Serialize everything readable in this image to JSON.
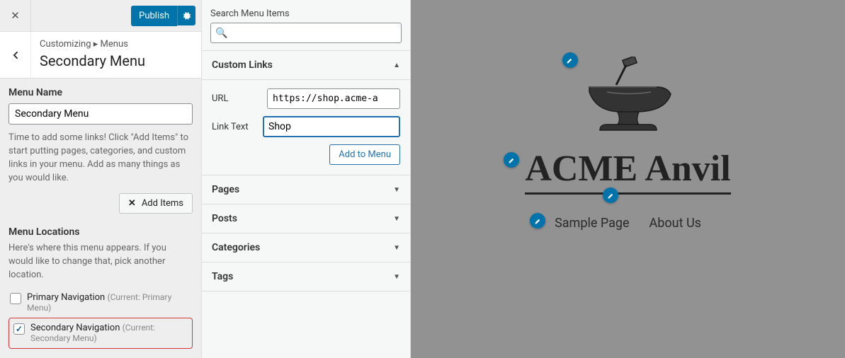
{
  "top": {
    "publish_label": "Publish"
  },
  "header": {
    "breadcrumb_prefix": "Customizing",
    "breadcrumb_section": "Menus",
    "title": "Secondary Menu"
  },
  "menu_name": {
    "label": "Menu Name",
    "value": "Secondary Menu"
  },
  "help": "Time to add some links! Click \"Add Items\" to start putting pages, categories, and custom links in your menu. Add as many things as you would like.",
  "add_items_label": "Add Items",
  "locations": {
    "label": "Menu Locations",
    "help": "Here's where this menu appears. If you would like to change that, pick another location.",
    "items": [
      {
        "label": "Primary Navigation",
        "current": "(Current: Primary Menu)",
        "checked": false,
        "highlight": false
      },
      {
        "label": "Secondary Navigation",
        "current": "(Current: Secondary Menu)",
        "checked": true,
        "highlight": true
      }
    ]
  },
  "search": {
    "label": "Search Menu Items",
    "value": ""
  },
  "accordions": {
    "custom_links": {
      "label": "Custom Links",
      "open": true,
      "url_label": "URL",
      "url_value": "https://shop.acme-a",
      "link_text_label": "Link Text",
      "link_text_value": "Shop",
      "add_label": "Add to Menu"
    },
    "pages": {
      "label": "Pages"
    },
    "posts": {
      "label": "Posts"
    },
    "categories": {
      "label": "Categories"
    },
    "tags": {
      "label": "Tags"
    }
  },
  "preview": {
    "site_title": "ACME Anvil",
    "nav": [
      "Sample Page",
      "About Us"
    ]
  }
}
